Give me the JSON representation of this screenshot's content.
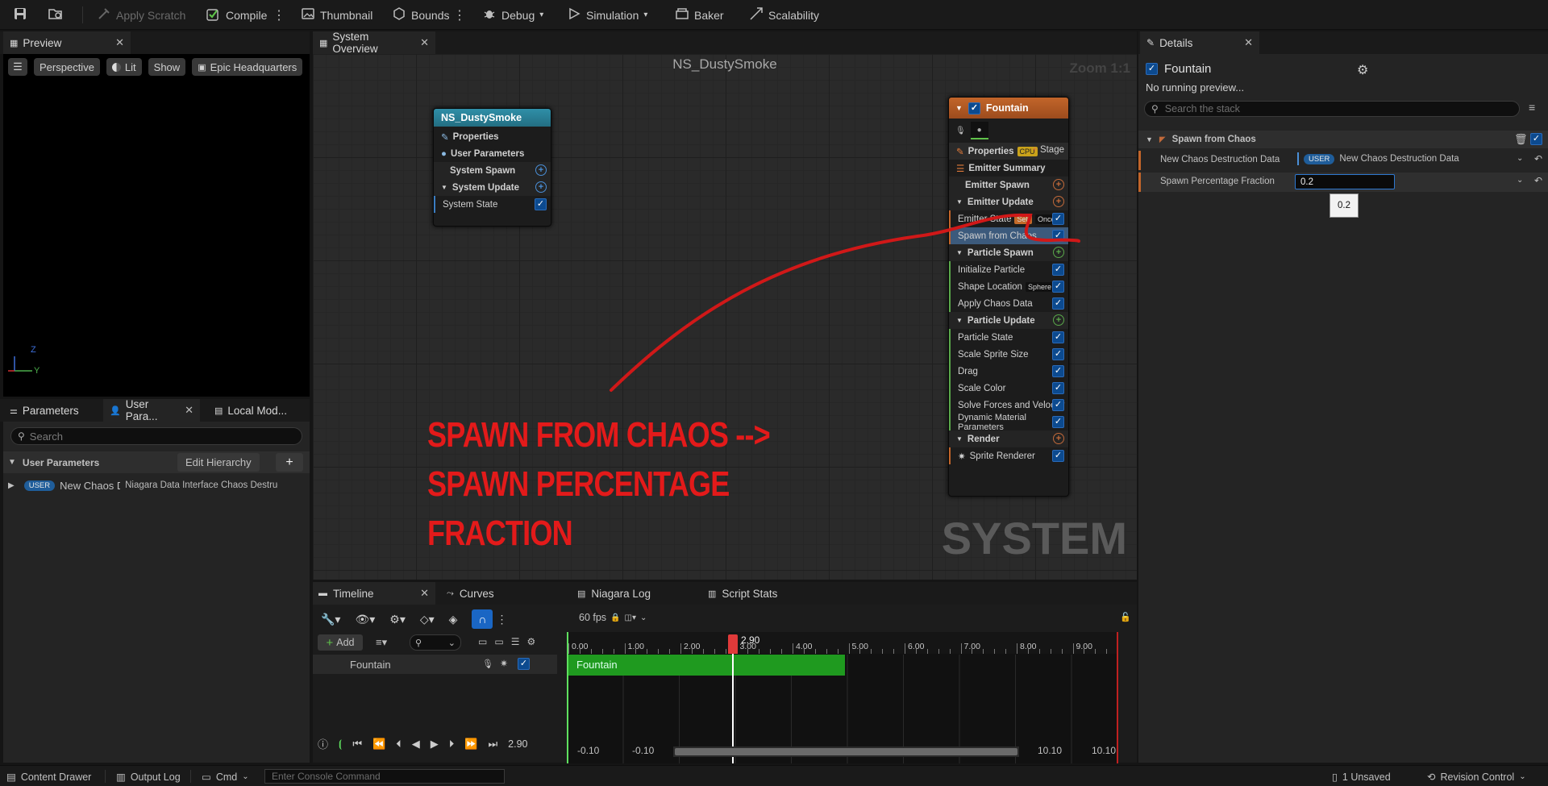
{
  "toolbar": {
    "apply_scratch": "Apply Scratch",
    "compile": "Compile",
    "thumbnail": "Thumbnail",
    "bounds": "Bounds",
    "debug": "Debug",
    "simulation": "Simulation",
    "baker": "Baker",
    "scalability": "Scalability"
  },
  "preview": {
    "tab": "Preview",
    "perspective": "Perspective",
    "lit": "Lit",
    "show": "Show",
    "level": "Epic Headquarters",
    "axis_z": "Z",
    "axis_y": "Y"
  },
  "params": {
    "tabs": [
      "Parameters",
      "User Para...",
      "Local Mod..."
    ],
    "search_placeholder": "Search",
    "section": "User Parameters",
    "edit_hierarchy": "Edit Hierarchy",
    "row_badge": "USER",
    "row_name": "New Chaos De",
    "row_type": "Niagara Data Interface Chaos Destruc"
  },
  "overview": {
    "tab": "System Overview",
    "title": "NS_DustySmoke",
    "zoom": "Zoom 1:1",
    "watermark": "SYSTEM",
    "annotation_lines": [
      "SPAWN FROM CHAOS -->",
      "SPAWN PERCENTAGE",
      "FRACTION"
    ],
    "system_node": {
      "title": "NS_DustySmoke",
      "properties": "Properties",
      "user_params": "User Parameters",
      "system_spawn": "System Spawn",
      "system_update": "System Update",
      "system_state": "System State"
    },
    "emitter_node": {
      "title": "Fountain",
      "properties": "Properties",
      "properties_tag": "CPU",
      "stage": "Stage",
      "emitter_summary": "Emitter Summary",
      "emitter_spawn": "Emitter Spawn",
      "emitter_update": "Emitter Update",
      "emitter_state": "Emitter State",
      "tag_self": "Self",
      "tag_once": "Once",
      "spawn_from_chaos": "Spawn from Chaos",
      "particle_spawn": "Particle Spawn",
      "initialize_particle": "Initialize Particle",
      "shape_location": "Shape Location",
      "tag_sphere": "Sphere",
      "apply_chaos_data": "Apply Chaos Data",
      "particle_update": "Particle Update",
      "particle_state": "Particle State",
      "scale_sprite_size": "Scale Sprite Size",
      "drag": "Drag",
      "scale_color": "Scale Color",
      "solve_forces": "Solve Forces and Velocity",
      "dynamic_material": "Dynamic Material Parameters",
      "render": "Render",
      "sprite_renderer": "Sprite Renderer"
    }
  },
  "details": {
    "tab": "Details",
    "emitter": "Fountain",
    "no_preview": "No running preview...",
    "search_placeholder": "Search the stack",
    "section": "Spawn from Chaos",
    "prop1_label": "New Chaos Destruction Data",
    "prop1_badge": "USER",
    "prop1_value": "New Chaos Destruction Data",
    "prop2_label": "Spawn Percentage Fraction",
    "prop2_value": "0.2",
    "tooltip": "0.2"
  },
  "timeline": {
    "tabs": [
      "Timeline",
      "Curves",
      "Niagara Log",
      "Script Stats"
    ],
    "fps": "60 fps",
    "add": "Add",
    "track": "Fountain",
    "bar_label": "Fountain",
    "playhead_label": "2.90",
    "ticks": [
      "0.00",
      "1.00",
      "2.00",
      "3.00",
      "4.00",
      "5.00",
      "6.00",
      "7.00",
      "8.00",
      "9.00"
    ],
    "current_time": "2.90",
    "range_start": "-0.10",
    "range_start2": "-0.10",
    "range_end": "10.10",
    "range_end2": "10.10"
  },
  "statusbar": {
    "content_drawer": "Content Drawer",
    "output_log": "Output Log",
    "cmd": "Cmd",
    "console_placeholder": "Enter Console Command",
    "unsaved": "1 Unsaved",
    "revision": "Revision Control"
  }
}
